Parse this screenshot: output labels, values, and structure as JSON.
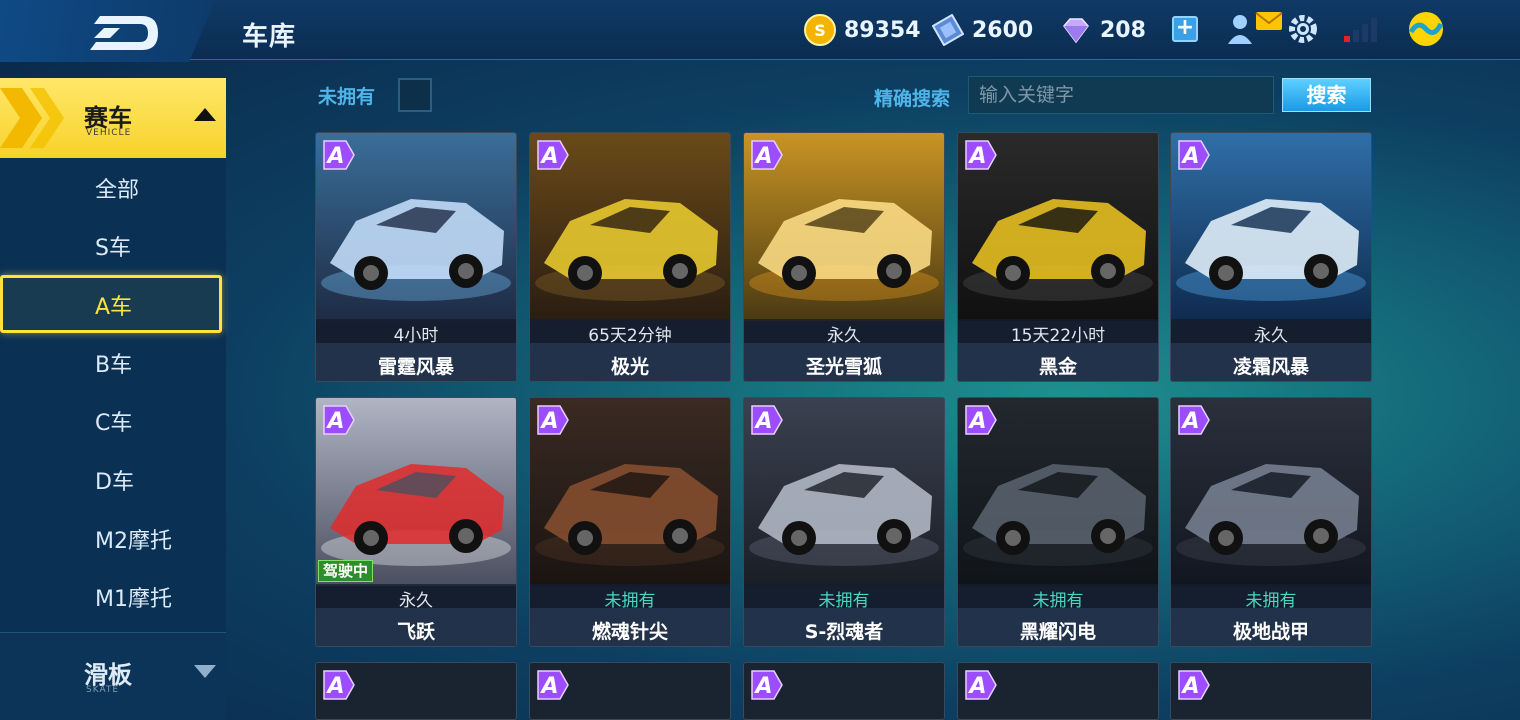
{
  "header": {
    "title": "车库",
    "coins": "89354",
    "coupons": "2600",
    "diamonds": "208",
    "plus_label": "+"
  },
  "sidebar": {
    "category": {
      "title": "赛车",
      "subtitle": "VEHICLE"
    },
    "items": [
      {
        "label": "全部"
      },
      {
        "label": "S车"
      },
      {
        "label": "A车"
      },
      {
        "label": "B车"
      },
      {
        "label": "C车"
      },
      {
        "label": "D车"
      },
      {
        "label": "M2摩托"
      },
      {
        "label": "M1摩托"
      }
    ],
    "active_index": 2,
    "category2": {
      "title": "滑板",
      "subtitle": "SKATE"
    }
  },
  "filter": {
    "unowned_label": "未拥有",
    "search_label": "精确搜索",
    "search_placeholder": "输入关键字",
    "search_button": "搜索"
  },
  "cars": [
    {
      "grade": "A",
      "duration": "4小时",
      "name": "雷霆风暴",
      "owned": true
    },
    {
      "grade": "A",
      "duration": "65天2分钟",
      "name": "极光",
      "owned": true
    },
    {
      "grade": "A",
      "duration": "永久",
      "name": "圣光雪狐",
      "owned": true
    },
    {
      "grade": "A",
      "duration": "15天22小时",
      "name": "黑金",
      "owned": true
    },
    {
      "grade": "A",
      "duration": "永久",
      "name": "凌霜风暴",
      "owned": true
    },
    {
      "grade": "A",
      "duration": "永久",
      "name": "飞跃",
      "owned": true,
      "badge": "驾驶中"
    },
    {
      "grade": "A",
      "duration": "未拥有",
      "name": "燃魂针尖",
      "owned": false
    },
    {
      "grade": "A",
      "duration": "未拥有",
      "name": "S-烈魂者",
      "owned": false
    },
    {
      "grade": "A",
      "duration": "未拥有",
      "name": "黑耀闪电",
      "owned": false
    },
    {
      "grade": "A",
      "duration": "未拥有",
      "name": "极地战甲",
      "owned": false
    }
  ],
  "colors": {
    "accent_yellow": "#ffe23a",
    "unowned_text": "#47d8c4",
    "label_blue": "#4fb4e8",
    "grade_purple": "#9b4dff"
  }
}
